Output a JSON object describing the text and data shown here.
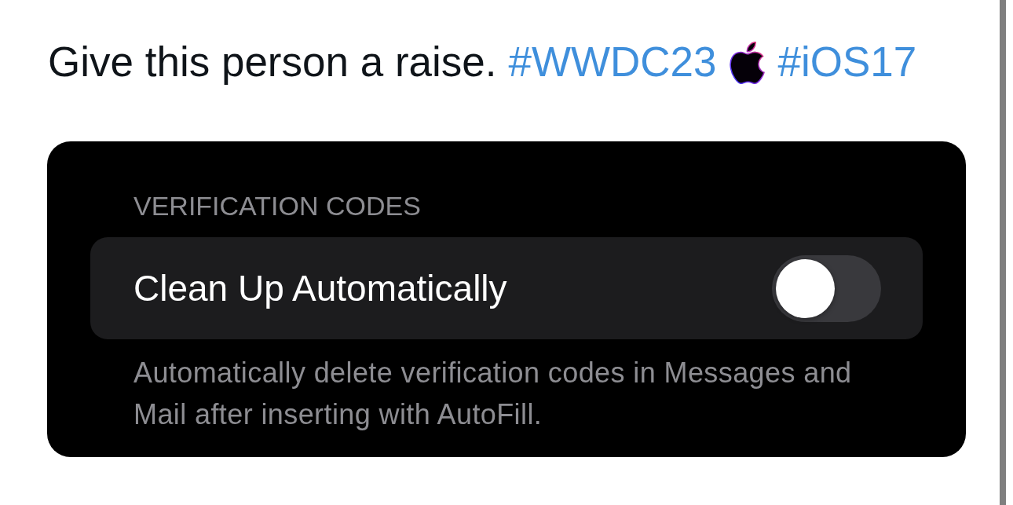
{
  "post": {
    "segments": [
      {
        "kind": "text",
        "text": "Give this person a raise."
      },
      {
        "kind": "hashtag",
        "text": "#WWDC23"
      },
      {
        "kind": "emoji"
      },
      {
        "kind": "hashtag",
        "text": "#iOS17"
      }
    ]
  },
  "settings_card": {
    "section_header": "VERIFICATION CODES",
    "toggle_row": {
      "label": "Clean Up Automatically",
      "on": false
    },
    "footer": "Automatically delete verification codes in Messages and Mail after inserting with AutoFill."
  }
}
